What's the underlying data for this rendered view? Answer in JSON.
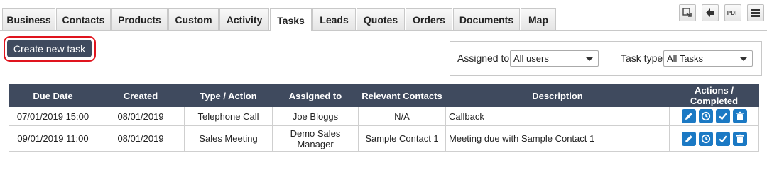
{
  "tabs": [
    {
      "label": "Business",
      "active": false
    },
    {
      "label": "Contacts",
      "active": false
    },
    {
      "label": "Products",
      "active": false
    },
    {
      "label": "Custom",
      "active": false
    },
    {
      "label": "Activity",
      "active": false
    },
    {
      "label": "Tasks",
      "active": true
    },
    {
      "label": "Leads",
      "active": false
    },
    {
      "label": "Quotes",
      "active": false
    },
    {
      "label": "Orders",
      "active": false
    },
    {
      "label": "Documents",
      "active": false
    },
    {
      "label": "Map",
      "active": false
    }
  ],
  "toolbar": {
    "buttons": [
      {
        "icon": "export-icon"
      },
      {
        "icon": "back-arrow-icon"
      },
      {
        "icon": "pdf-icon",
        "label": "PDF"
      },
      {
        "icon": "drawer-icon"
      }
    ]
  },
  "create_button": {
    "label": "Create new task"
  },
  "filters": {
    "assigned_label": "Assigned to",
    "assigned_value": "All users",
    "type_label": "Task type",
    "type_value": "All Tasks"
  },
  "table": {
    "columns": [
      "Due Date",
      "Created",
      "Type / Action",
      "Assigned to",
      "Relevant Contacts",
      "Description",
      "Actions / Completed"
    ],
    "rows": [
      {
        "due": "07/01/2019 15:00",
        "created": "08/01/2019",
        "type": "Telephone Call",
        "assigned": "Joe Bloggs",
        "contacts": "N/A",
        "description": "Callback"
      },
      {
        "due": "09/01/2019 11:00",
        "created": "08/01/2019",
        "type": "Sales Meeting",
        "assigned": "Demo Sales Manager",
        "contacts": "Sample Contact 1",
        "description": "Meeting due with Sample Contact 1"
      }
    ]
  },
  "colors": {
    "header_bg": "#3f4a5e",
    "action_blue": "#1b79c4",
    "highlight_red": "#e0141e"
  }
}
